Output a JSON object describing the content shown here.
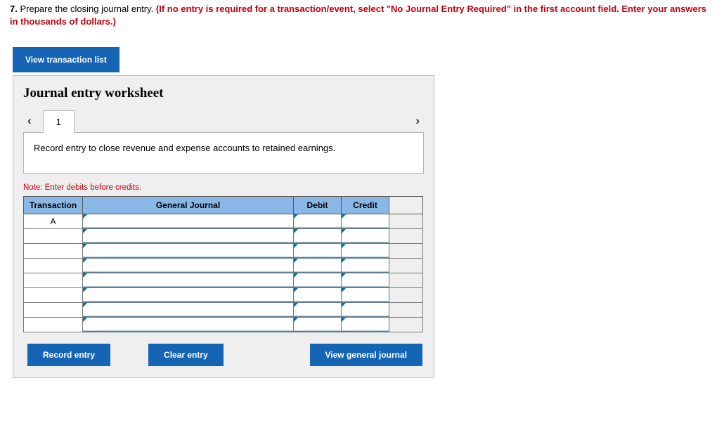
{
  "question": {
    "number": "7.",
    "text": "Prepare the closing journal entry.",
    "note": "(If no entry is required for a transaction/event, select \"No Journal Entry Required\" in the first account field. Enter your answers in thousands of dollars.)"
  },
  "buttons": {
    "view_transaction_list": "View transaction list",
    "record_entry": "Record entry",
    "clear_entry": "Clear entry",
    "view_general_journal": "View general journal"
  },
  "worksheet": {
    "title": "Journal entry worksheet",
    "tab_label": "1",
    "instruction": "Record entry to close revenue and expense accounts to retained earnings.",
    "note": "Note: Enter debits before credits.",
    "columns": {
      "transaction": "Transaction",
      "general_journal": "General Journal",
      "debit": "Debit",
      "credit": "Credit"
    },
    "first_transaction_label": "A"
  }
}
